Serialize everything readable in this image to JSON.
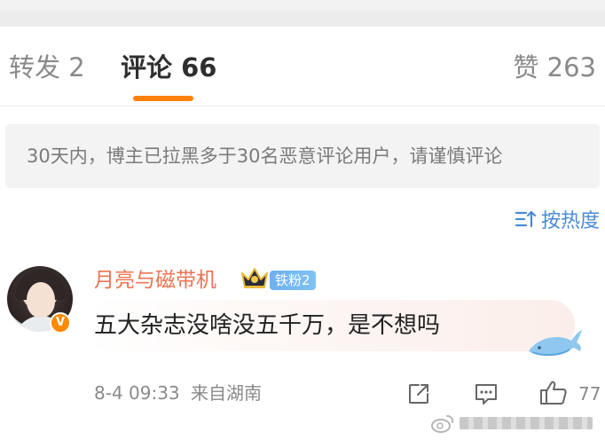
{
  "tabs": {
    "repost": "转发 2",
    "comments": "评论 66",
    "likes": "赞 263",
    "active": "comments",
    "accent_color": "#ff8200"
  },
  "notice": {
    "text": "30天内，博主已拉黑多于30名恶意评论用户，请谨慎评论"
  },
  "sort": {
    "icon": "sort-icon",
    "label": "按热度"
  },
  "comment": {
    "username": "月亮与磁带机",
    "fan_badge": "铁粉2",
    "verified_icon": "verified-v-icon",
    "crown_icon": "crown-icon",
    "text": "五大杂志没啥没五千万，是不想吗",
    "time": "8-4 09:33",
    "source": "来自湖南",
    "like_count": "77",
    "username_color": "#eb7350"
  }
}
